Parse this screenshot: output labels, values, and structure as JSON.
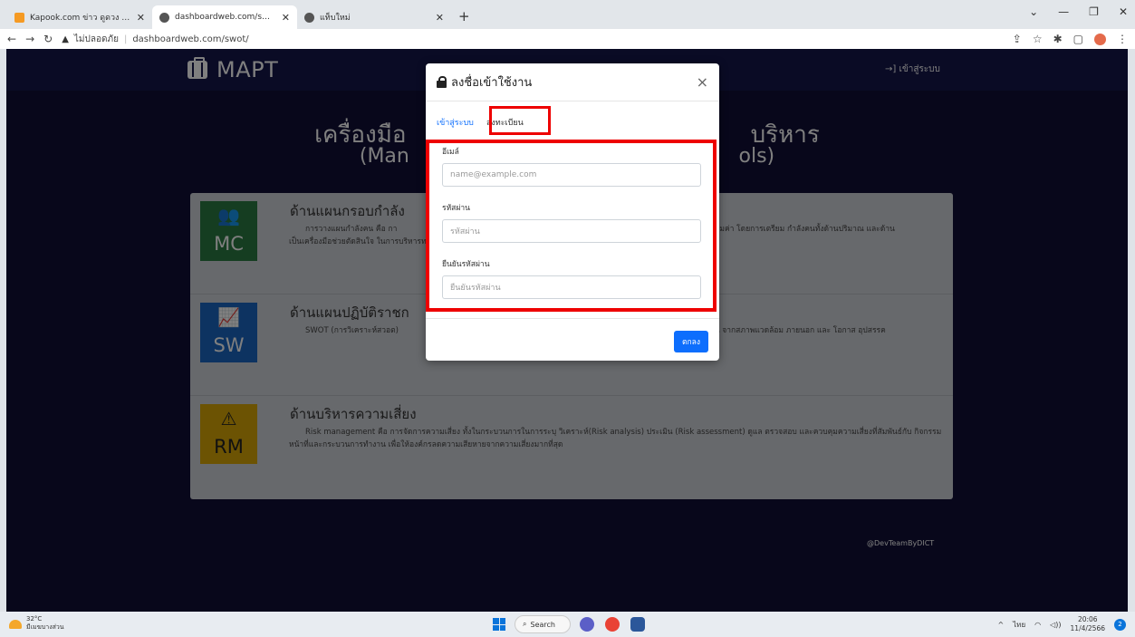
{
  "browser": {
    "tabs": [
      {
        "title": "Kapook.com ข่าว ดูดวง ตรวจหวย ดูละคร",
        "color": "#f59a23"
      },
      {
        "title": "dashboardweb.com/swot/",
        "color": "#555555"
      },
      {
        "title": "แท็บใหม่",
        "color": "#555555"
      }
    ],
    "new_tab": "+",
    "window_controls": {
      "minimize": "—",
      "maximize": "❐",
      "close": "✕"
    },
    "security_label": "ไม่ปลอดภัย",
    "url": "dashboardweb.com/swot/"
  },
  "navbar": {
    "brand": "MAPT",
    "login_link": "→] เข้าสู่ระบบ"
  },
  "hero": {
    "title": "เครื่องมือ                                              บริหาร",
    "subtitle": "(Man                                                    ols)"
  },
  "cards": [
    {
      "code": "MC",
      "icon": "users-icon",
      "color": "#2a7a43",
      "title": "ด้านแผนกรอบกำลัง",
      "text": "การวางแผนกำลังคน คือ กา                                                                                           เกิดประสิทธิภาพ และมีความคุ้มค่า โดยการเตรียม กำลังคนทั้งด้านปริมาณ และด้าน                                                                                          เป็นเครื่องมือช่วยตัดสินใจ ในการบริหารทรัพยากรบุคคล"
    },
    {
      "code": "SW",
      "icon": "chart-line-icon",
      "color": "#1a66c2",
      "title": "ด้านแผนปฏิบัติราชก",
      "text": "SWOT (การวิเคราะห์สวอต)                                                                                               ระกอบด้วย จุดแข็ง จุดอ่อน จากสภาพแวดล้อม ภายนอก และ โอกาส อุปสรรค"
    },
    {
      "code": "RM",
      "icon": "warning-icon",
      "color": "#d8a606",
      "title": "ด้านบริหารความเสี่ยง",
      "text": "Risk management คือ การจัดการความเสี่ยง ทั้งในกระบวนการในการระบุ วิเคราะห์(Risk analysis) ประเมิน (Risk assessment) ดูแล ตรวจสอบ และควบคุมความเสี่ยงที่สัมพันธ์กับ กิจกรรม หน้าที่และกระบวนการทำงาน เพื่อให้องค์กรลดความเสียหายจากความเสี่ยงมากที่สุด"
    }
  ],
  "footer_credit": "@DevTeamByDICT",
  "modal": {
    "title": "ลงชื่อเข้าใช้งาน",
    "close": "×",
    "tab_login": "เข้าสู่ระบบ",
    "tab_register": "ลงทะเบียน",
    "email_label": "อีเมล์",
    "email_placeholder": "name@example.com",
    "password_label": "รหัสผ่าน",
    "password_placeholder": "รหัสผ่าน",
    "confirm_label": "ยืนยันรหัสผ่าน",
    "confirm_placeholder": "ยืนยันรหัสผ่าน",
    "submit": "ตกลง"
  },
  "taskbar": {
    "temperature": "32°C",
    "weather": "มีเมฆบางส่วน",
    "search": "Search",
    "language": "ไทย",
    "time": "20:06",
    "date": "11/4/2566",
    "notifications": "2"
  }
}
